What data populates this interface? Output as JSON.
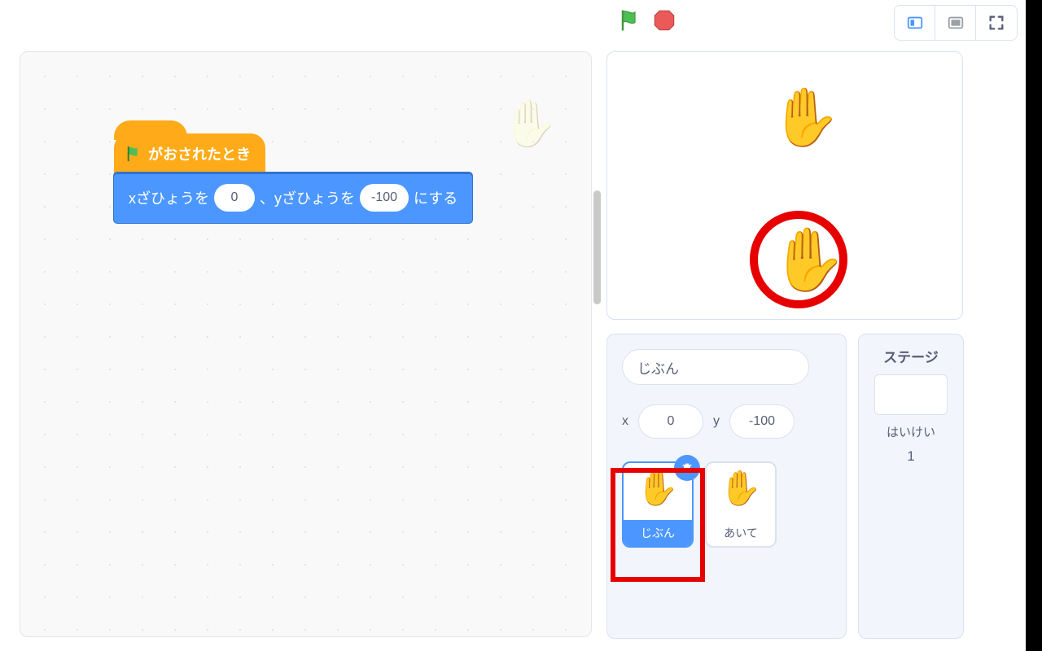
{
  "blocks": {
    "hat_label": "がおされたとき",
    "goto_prefix": "xざひょうを",
    "goto_mid": "、yざひょうを",
    "goto_suffix": "にする",
    "x_value": "0",
    "y_value": "-100"
  },
  "sprite_info": {
    "name": "じぶん",
    "x_label": "x",
    "y_label": "y",
    "x": "0",
    "y": "-100"
  },
  "sprites": [
    {
      "name": "じぶん",
      "icon": "✋",
      "selected": true
    },
    {
      "name": "あいて",
      "icon": "✋",
      "selected": false
    }
  ],
  "stage_panel": {
    "title": "ステージ",
    "backdrop_label": "はいけい",
    "backdrop_count": "1"
  },
  "icons": {
    "hand": "✋"
  }
}
